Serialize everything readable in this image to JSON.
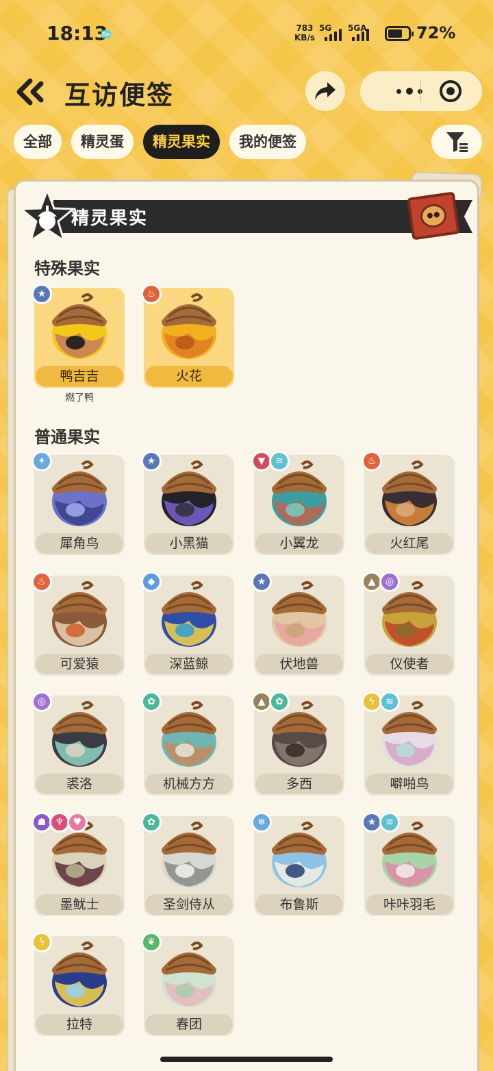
{
  "status": {
    "time": "18:13",
    "app_badge": "Tap",
    "net_speed_value": "783",
    "net_speed_unit": "KB/s",
    "sim1": "5G",
    "sim2": "5GA",
    "battery": "72%",
    "battery_level": 0.72
  },
  "nav": {
    "title": "互访便签"
  },
  "tabs": [
    {
      "label": "全部",
      "active": false
    },
    {
      "label": "精灵蛋",
      "active": false
    },
    {
      "label": "精灵果实",
      "active": true
    },
    {
      "label": "我的便签",
      "active": false
    }
  ],
  "card": {
    "banner_title": "精灵果实"
  },
  "special": {
    "title": "特殊果实",
    "items": [
      {
        "name": "鸭吉吉",
        "sub": "燃了鸭",
        "badges": [
          "star"
        ],
        "colors": [
          "#f2c91b",
          "#c77d5a",
          "#1b1b1b"
        ]
      },
      {
        "name": "火花",
        "sub": "",
        "badges": [
          "fire"
        ],
        "colors": [
          "#f0b020",
          "#e07a24",
          "#b85a18"
        ]
      }
    ]
  },
  "normal": {
    "title": "普通果实",
    "items": [
      {
        "name": "犀角鸟",
        "badges": [
          "ice"
        ],
        "colors": [
          "#6b73c9",
          "#3a3f8a",
          "#9ea6ea"
        ]
      },
      {
        "name": "小黑猫",
        "badges": [
          "star"
        ],
        "colors": [
          "#222228",
          "#7a5fd0",
          "#33333b"
        ]
      },
      {
        "name": "小翼龙",
        "badges": [
          "dragon",
          "wing"
        ],
        "colors": [
          "#3b9ea0",
          "#c6614b",
          "#79c7b9"
        ]
      },
      {
        "name": "火红尾",
        "badges": [
          "fire"
        ],
        "colors": [
          "#3a2e35",
          "#e08b3a",
          "#d9a87a"
        ]
      },
      {
        "name": "可爱猿",
        "badges": [
          "fire"
        ],
        "colors": [
          "#8a5a3a",
          "#e8d3b6",
          "#d06432"
        ]
      },
      {
        "name": "深蓝鲸",
        "badges": [
          "water"
        ],
        "colors": [
          "#2f4ea5",
          "#f5d34a",
          "#3a9fd0"
        ]
      },
      {
        "name": "伏地兽",
        "badges": [
          "star"
        ],
        "colors": [
          "#e3c7a2",
          "#e8a2a0",
          "#c9a47a"
        ]
      },
      {
        "name": "仪使者",
        "badges": [
          "ground",
          "psychic"
        ],
        "colors": [
          "#c9a23a",
          "#c0432d",
          "#8a6a2a"
        ]
      },
      {
        "name": "裘洛",
        "badges": [
          "psychic"
        ],
        "colors": [
          "#3b3b45",
          "#8fd3c0",
          "#d7d2c3"
        ]
      },
      {
        "name": "机械方方",
        "badges": [
          "gear"
        ],
        "colors": [
          "#6fb5b3",
          "#c98a5a",
          "#e3e0d6"
        ]
      },
      {
        "name": "多西",
        "badges": [
          "ground",
          "gear"
        ],
        "colors": [
          "#5a4a45",
          "#8a7a72",
          "#3a2f2c"
        ]
      },
      {
        "name": "噼啪鸟",
        "badges": [
          "electric",
          "wing"
        ],
        "colors": [
          "#e7dbe6",
          "#d4a5c7",
          "#b8ddd6"
        ]
      },
      {
        "name": "墨鱿士",
        "badges": [
          "ghost",
          "demon",
          "fairy"
        ],
        "colors": [
          "#d9d4b9",
          "#5b2a3a",
          "#b5ae8b"
        ]
      },
      {
        "name": "圣剑侍从",
        "badges": [
          "gear"
        ],
        "colors": [
          "#d8d8d2",
          "#8a8a86",
          "#f0efe9"
        ]
      },
      {
        "name": "布鲁斯",
        "badges": [
          "ice2"
        ],
        "colors": [
          "#8fc3e6",
          "#f5f0e0",
          "#2e4a7a"
        ]
      },
      {
        "name": "咔咔羽毛",
        "badges": [
          "star",
          "wing"
        ],
        "colors": [
          "#a7d4a8",
          "#e08aa8",
          "#efe7e9"
        ]
      },
      {
        "name": "拉特",
        "badges": [
          "electric"
        ],
        "colors": [
          "#2a3d8a",
          "#f5d34a",
          "#9ad0e8"
        ]
      },
      {
        "name": "春团",
        "badges": [
          "grass"
        ],
        "colors": [
          "#cfe4d0",
          "#e8b8c0",
          "#a8ccae"
        ]
      }
    ]
  },
  "badge_styles": {
    "star": {
      "color": "#5a78b8",
      "glyph": "★"
    },
    "fire": {
      "color": "#e0643a",
      "glyph": "♨"
    },
    "ice": {
      "color": "#6aa8e0",
      "glyph": "✦"
    },
    "ice2": {
      "color": "#6aa8e0",
      "glyph": "❄"
    },
    "dragon": {
      "color": "#d64a5a",
      "glyph": "▼"
    },
    "wing": {
      "color": "#5ec0d0",
      "glyph": "≋"
    },
    "water": {
      "color": "#5a9ee0",
      "glyph": "◆"
    },
    "ground": {
      "color": "#9a8258",
      "glyph": "▲"
    },
    "psychic": {
      "color": "#a070d0",
      "glyph": "◎"
    },
    "gear": {
      "color": "#4ab89a",
      "glyph": "✿"
    },
    "electric": {
      "color": "#e8c23a",
      "glyph": "ϟ"
    },
    "ghost": {
      "color": "#8a58c8",
      "glyph": "☗"
    },
    "demon": {
      "color": "#d8507a",
      "glyph": "♆"
    },
    "fairy": {
      "color": "#e87aa0",
      "glyph": "♥"
    },
    "grass": {
      "color": "#58b868",
      "glyph": "❦"
    }
  }
}
